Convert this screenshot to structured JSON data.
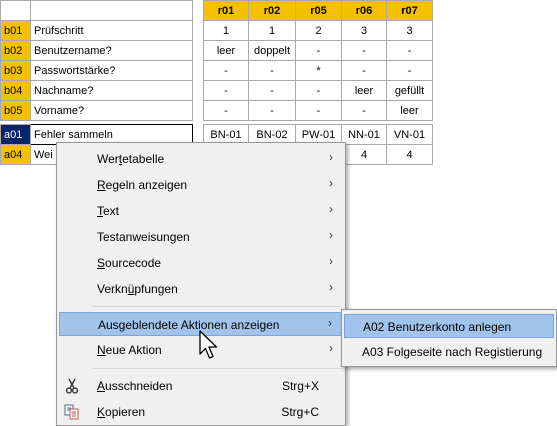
{
  "columns": [
    "r01",
    "r02",
    "r05",
    "r06",
    "r07"
  ],
  "top_rows": [
    {
      "id": "b01",
      "label": "Prüfschritt",
      "cells": [
        "1",
        "1",
        "2",
        "3",
        "3"
      ]
    },
    {
      "id": "b02",
      "label": "Benutzername?",
      "cells": [
        "leer",
        "doppelt",
        "-",
        "-",
        "-"
      ]
    },
    {
      "id": "b03",
      "label": "Passwortstärke?",
      "cells": [
        "-",
        "-",
        "*",
        "-",
        "-"
      ]
    },
    {
      "id": "b04",
      "label": "Nachname?",
      "cells": [
        "-",
        "-",
        "-",
        "leer",
        "gefüllt"
      ]
    },
    {
      "id": "b05",
      "label": "Vorname?",
      "cells": [
        "-",
        "-",
        "-",
        "-",
        "leer"
      ]
    }
  ],
  "bottom_rows": [
    {
      "id": "a01",
      "label": "Fehler sammeln",
      "cells": [
        "BN-01",
        "BN-02",
        "PW-01",
        "NN-01",
        "VN-01"
      ]
    },
    {
      "id": "a04",
      "label": "Wei",
      "cells": [
        "",
        "",
        "",
        "4",
        "4"
      ]
    }
  ],
  "context_menu": {
    "items": [
      {
        "pre": "",
        "ul": "",
        "post": "Wertetabelle",
        "display": [
          "Wer",
          "t",
          "etabelle"
        ],
        "submenu": true
      },
      {
        "display": [
          "",
          "R",
          "egeln anzeigen"
        ],
        "submenu": true
      },
      {
        "display": [
          "",
          "T",
          "ext"
        ],
        "submenu": true
      },
      {
        "display": [
          "Testanweisungen",
          "",
          ""
        ],
        "submenu": true
      },
      {
        "display": [
          "",
          "S",
          "ourcecode"
        ],
        "submenu": true
      },
      {
        "display": [
          "Verkn",
          "ü",
          "pfungen"
        ],
        "submenu": true
      },
      {
        "display": [
          "Ausgeblendete Aktionen anzeigen",
          "",
          ""
        ],
        "submenu": true
      },
      {
        "display": [
          "",
          "N",
          "eue Aktion"
        ],
        "submenu": true
      },
      {
        "display": [
          "",
          "A",
          "usschneiden"
        ],
        "shortcut": "Strg+X"
      },
      {
        "display": [
          "",
          "K",
          "opieren"
        ],
        "shortcut": "Strg+C"
      }
    ],
    "arrow": "›"
  },
  "submenu": {
    "items": [
      "A02 Benutzerkonto anlegen",
      "A03 Folgeseite nach Registierung"
    ]
  },
  "icons": {
    "cut": "scissors-icon",
    "copy": "copy-icon",
    "cursor": "mouse-pointer-icon"
  },
  "colors": {
    "id_cell": "#f5c000",
    "id_selected": "#0a246a",
    "menu_highlight": "#a2c4ec"
  }
}
